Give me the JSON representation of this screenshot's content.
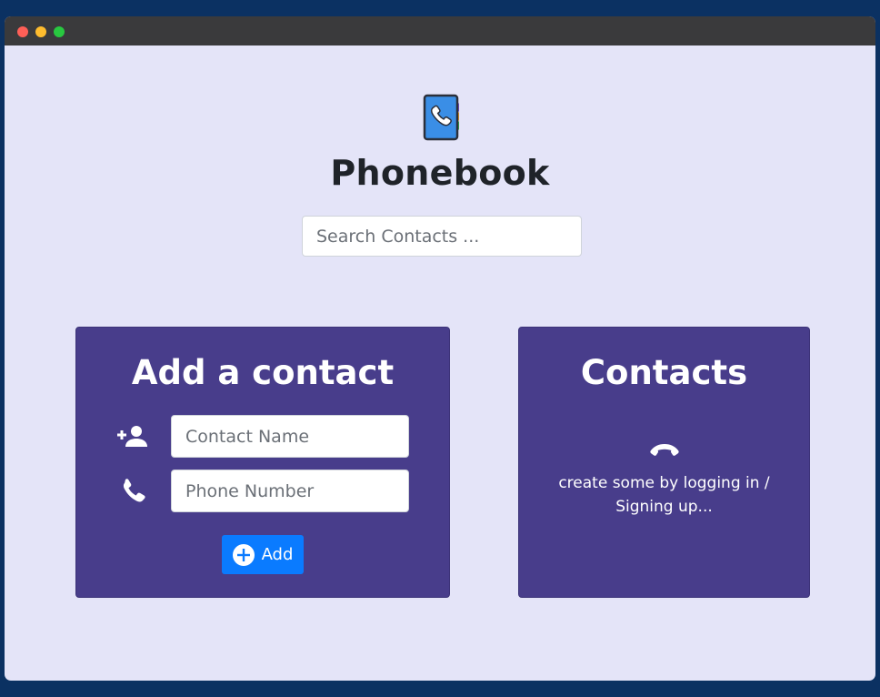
{
  "window": {
    "controls": [
      "close",
      "minimize",
      "zoom"
    ]
  },
  "header": {
    "logo_icon": "phonebook-icon",
    "title": "Phonebook",
    "search_placeholder": "Search Contacts ..."
  },
  "add_card": {
    "title": "Add a contact",
    "name_icon": "add-person-icon",
    "name_placeholder": "Contact Name",
    "phone_icon": "phone-icon",
    "phone_placeholder": "Phone Number",
    "add_button_icon": "plus-circle-icon",
    "add_button_label": "Add"
  },
  "contacts_card": {
    "title": "Contacts",
    "empty_icon": "hang-up-phone-icon",
    "empty_message": "create some by logging in / Signing up..."
  },
  "colors": {
    "outer_background": "#0b3162",
    "page_background": "#e4e4f8",
    "card_background": "#483d8b",
    "button_primary": "#0a7bff",
    "titlebar": "#3a3a3c"
  }
}
